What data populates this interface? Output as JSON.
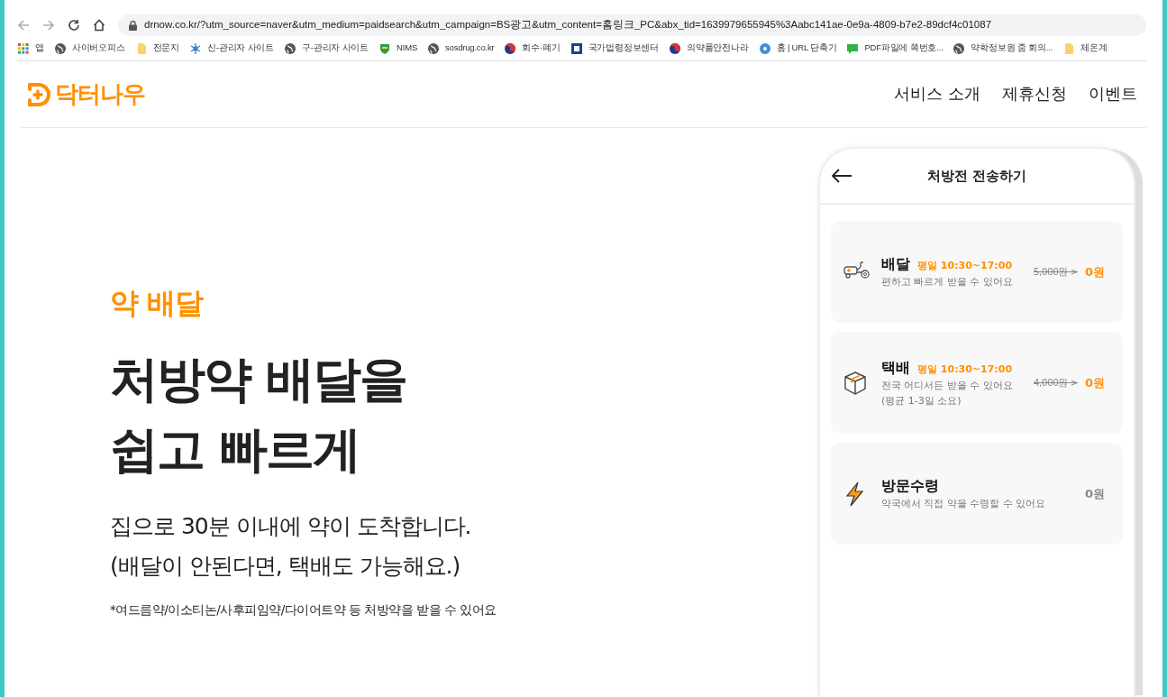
{
  "browser": {
    "url": "drnow.co.kr/?utm_source=naver&utm_medium=paidsearch&utm_campaign=BS광고&utm_content=홈링크_PC&abx_tid=1639979655945%3Aabc141ae-0e9a-4809-b7e2-89dcf4c01087",
    "bookmarks": [
      {
        "kind": "apps",
        "label": "앱"
      },
      {
        "kind": "globe",
        "label": "사이버오피스"
      },
      {
        "kind": "folder",
        "label": "전문지"
      },
      {
        "kind": "snowflake",
        "label": "신-관리자 사이트"
      },
      {
        "kind": "globe",
        "label": "구-관리자 사이트"
      },
      {
        "kind": "shield",
        "label": "NIMS"
      },
      {
        "kind": "globe",
        "label": "sosdrug.co.kr"
      },
      {
        "kind": "emblem",
        "label": "회수·폐기"
      },
      {
        "kind": "square",
        "label": "국가법령정보센터"
      },
      {
        "kind": "emblem",
        "label": "의약품안전나라"
      },
      {
        "kind": "disc",
        "label": "홈 | URL 단축기"
      },
      {
        "kind": "chat",
        "label": "PDF파일에 쪽번호..."
      },
      {
        "kind": "globe",
        "label": "약학정보원 줌 회의..."
      },
      {
        "kind": "folder",
        "label": "체온계"
      }
    ]
  },
  "header": {
    "logo": "닥터나우",
    "nav": [
      {
        "label": "서비스 소개"
      },
      {
        "label": "제휴신청"
      },
      {
        "label": "이벤트"
      }
    ]
  },
  "hero": {
    "category": "약 배달",
    "headline": [
      "처방약 배달을",
      "쉽고 빠르게"
    ],
    "description": [
      "집으로 30분 이내에 약이 도착합니다.",
      "(배달이 안된다면, 택배도 가능해요.)"
    ],
    "note": "*여드름약/이소티논/사후피임약/다이어트약 등 처방약을 받을 수 있어요"
  },
  "phone": {
    "title": "처방전 전송하기",
    "options": [
      {
        "kind": "scooter",
        "name": "배달",
        "hours": "평일 10:30~17:00",
        "description": [
          "편하고 빠르게 받을 수 있어요"
        ],
        "original_price": "5,000원 >",
        "price": "0원",
        "discounted": true
      },
      {
        "kind": "box",
        "name": "택배",
        "hours": "평일 10:30~17:00",
        "description": [
          "전국 어디서든 받을 수 있어요",
          "(평균 1-3일 소요)"
        ],
        "original_price": "4,000원 >",
        "price": "0원",
        "discounted": true
      },
      {
        "kind": "bolt",
        "name": "방문수령",
        "description": [
          "약국에서 직접 약을 수령할 수 있어요"
        ],
        "price": "0원",
        "discounted": false
      }
    ]
  }
}
